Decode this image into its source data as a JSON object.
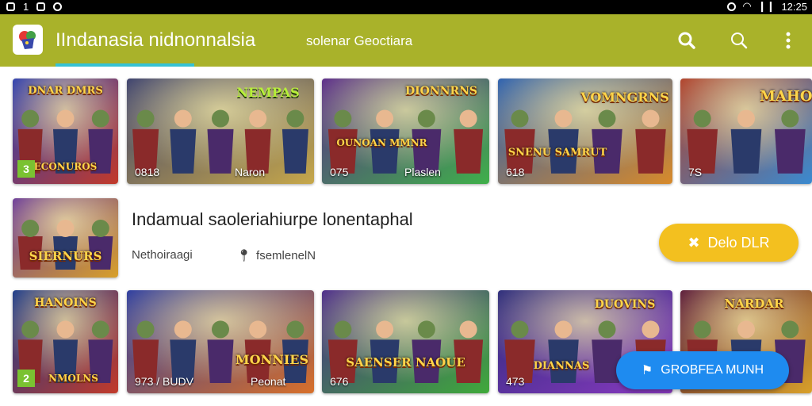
{
  "status_bar": {
    "left_number": "1",
    "time": "12:25"
  },
  "app_bar": {
    "title": "IIndanasia nidnonnalsia",
    "sub_tab": "solenar Geoctiara",
    "icons": [
      "search-icon",
      "search-outline-icon",
      "more-vert-icon"
    ],
    "color": "#a9b22a",
    "indicator_color": "#35c2d3"
  },
  "row1": [
    {
      "caption": "",
      "badge": "3",
      "art_text": "ECONUROS",
      "art_top": "DNAR DMRS",
      "colors": [
        "#2d3fb0",
        "#c23a2a"
      ]
    },
    {
      "caption": "0818",
      "caption2": "Naron",
      "art_text": "NEMPAS",
      "art_top": "",
      "colors": [
        "#3a3f6e",
        "#c7a84a"
      ]
    },
    {
      "caption": "075",
      "caption2": "Plaslen",
      "art_text": "OUNOAN MMNR",
      "art_top": "DIONNRNS",
      "colors": [
        "#5a2a8a",
        "#3fb04a"
      ]
    },
    {
      "caption": "618",
      "caption2": "",
      "art_text": "SNENU SAMRUT",
      "art_top": "VOMNGRNS",
      "colors": [
        "#2a5fb0",
        "#d88a2a"
      ]
    },
    {
      "caption": "7S",
      "caption2": "",
      "art_text": "MAHO",
      "art_top": "",
      "colors": [
        "#b0402a",
        "#3a8ad0"
      ]
    }
  ],
  "feature": {
    "art_text": "SIERNURS",
    "title": "Indamual saoleriahiurpe lonentaphal",
    "meta1": "Nethoiraagi",
    "meta2": "fsemlenelN",
    "button_label": "Delo DLR"
  },
  "row2": [
    {
      "caption": "",
      "badge": "2",
      "art_text": "NMOLNS",
      "art_top": "HANOINS",
      "colors": [
        "#1a3a8a",
        "#c23a2a"
      ]
    },
    {
      "caption": "973 / BUDV",
      "caption2": "",
      "art_text": "MONNIES",
      "art_top": "",
      "colors": [
        "#2a3aa0",
        "#d8702a"
      ]
    },
    {
      "caption": "676",
      "caption2": "",
      "art_text": "SAENSER NAOUE",
      "art_top": "",
      "colors": [
        "#4a2a8a",
        "#3faa3a"
      ]
    },
    {
      "caption": "473",
      "caption2": "",
      "art_text": "DIANNAS",
      "art_top": "DUOVINS",
      "colors": [
        "#2a2a7a",
        "#8a3ac0"
      ]
    },
    {
      "caption": "",
      "caption2": "",
      "art_text": "NARDAR",
      "art_top": "",
      "colors": [
        "#5a1a3a",
        "#d8a02a"
      ]
    }
  ],
  "row2_extra": {
    "caption_tile2": "Peonat"
  },
  "fab": {
    "label": "GROBFEA MUNH",
    "color": "#1e8bf0"
  },
  "demo_color": "#f3c01f"
}
